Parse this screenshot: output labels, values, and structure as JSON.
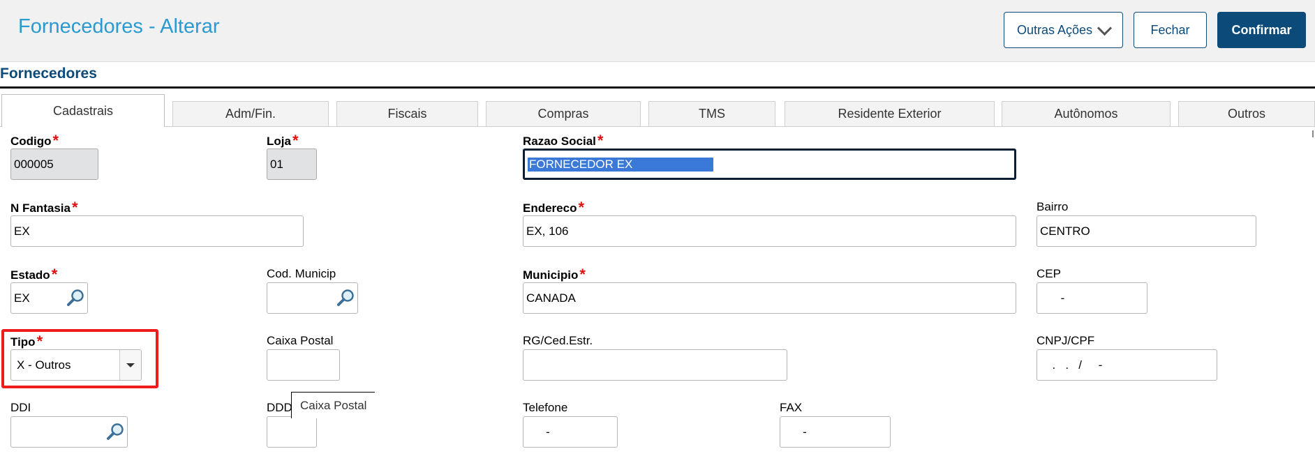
{
  "header": {
    "title": "Fornecedores - Alterar",
    "actions": {
      "outras_acoes": "Outras Ações",
      "fechar": "Fechar",
      "confirmar": "Confirmar"
    }
  },
  "section": {
    "title": "Fornecedores"
  },
  "tabs": [
    "Cadastrais",
    "Adm/Fin.",
    "Fiscais",
    "Compras",
    "TMS",
    "Residente Exterior",
    "Autônomos",
    "Outros"
  ],
  "active_tab": "Cadastrais",
  "fields": {
    "codigo": {
      "label": "Codigo",
      "value": "000005"
    },
    "loja": {
      "label": "Loja",
      "value": "01"
    },
    "razao_social": {
      "label": "Razao Social",
      "value": "FORNECEDOR EX"
    },
    "n_fantasia": {
      "label": "N Fantasia",
      "value": "EX"
    },
    "endereco": {
      "label": "Endereco",
      "value": "EX, 106"
    },
    "bairro": {
      "label": "Bairro",
      "value": "CENTRO"
    },
    "estado": {
      "label": "Estado",
      "value": "EX"
    },
    "cod_municip": {
      "label": "Cod. Municip",
      "value": ""
    },
    "municipio": {
      "label": "Municipio",
      "value": "CANADA"
    },
    "cep": {
      "label": "CEP",
      "value": "     -"
    },
    "tipo": {
      "label": "Tipo",
      "value": "X - Outros"
    },
    "caixa_postal": {
      "label": "Caixa Postal",
      "value": ""
    },
    "rg_ced_estr": {
      "label": "RG/Ced.Estr.",
      "value": ""
    },
    "cnpj_cpf": {
      "label": "CNPJ/CPF",
      "value": "  .   .   /     -"
    },
    "ddi": {
      "label": "DDI",
      "value": ""
    },
    "ddd": {
      "label": "DDD",
      "value": ""
    },
    "telefone": {
      "label": "Telefone",
      "value": "   -"
    },
    "fax": {
      "label": "FAX",
      "value": "   -"
    }
  },
  "tooltip": {
    "text": "Caixa Postal"
  },
  "colors": {
    "title": "#2b9ad0",
    "brand_dark": "#0c4a79",
    "required": "#e01010",
    "highlight": "#ee1c1c",
    "selection": "#3b79d8"
  },
  "icons": {
    "lookup": "magnifier-icon",
    "dropdown": "chevron-down-icon"
  }
}
